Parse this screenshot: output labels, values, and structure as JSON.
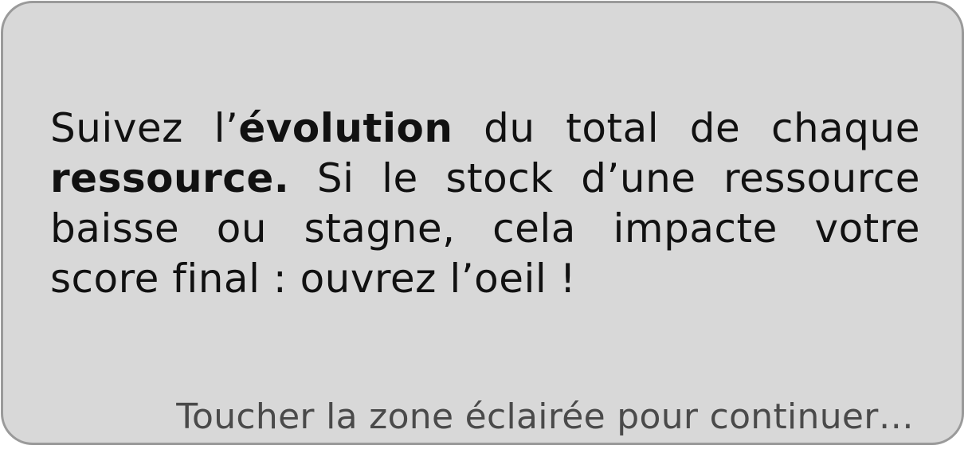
{
  "tutorial": {
    "message": {
      "part1": "Suivez l’",
      "part2_bold": "évolution",
      "part3": " du total de chaque ",
      "part4_bold": "ressource.",
      "part5": " Si le stock d’une ressource baisse ou stagne, cela impacte votre score final : ouvrez l’oeil !"
    },
    "continue_hint": "Toucher la zone éclairée pour continuer…"
  }
}
